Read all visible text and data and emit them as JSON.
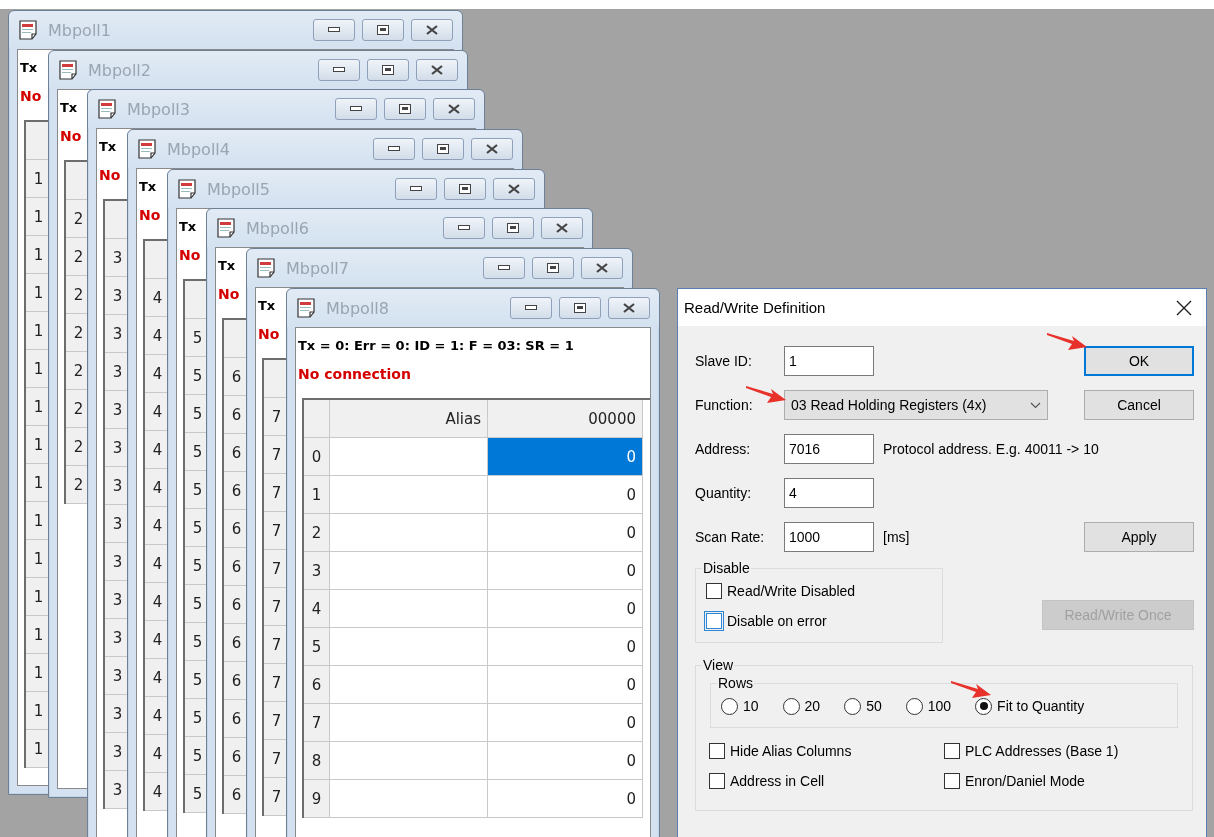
{
  "windows": [
    {
      "title": "Mbpoll1",
      "status": "Tx",
      "connection": "No",
      "row_headers": [
        "1",
        "1",
        "1",
        "1",
        "1",
        "1",
        "1",
        "1",
        "1",
        "1",
        "1",
        "1",
        "1",
        "1",
        "1",
        "1"
      ]
    },
    {
      "title": "Mbpoll2",
      "status": "Tx",
      "connection": "No",
      "row_headers": [
        "2",
        "2",
        "2",
        "2",
        "2",
        "2",
        "2",
        "2"
      ]
    },
    {
      "title": "Mbpoll3",
      "status": "Tx",
      "connection": "No",
      "row_headers": [
        "3",
        "3",
        "3",
        "3",
        "3",
        "3",
        "3",
        "3",
        "3",
        "3",
        "3",
        "3",
        "3",
        "3",
        "3"
      ]
    },
    {
      "title": "Mbpoll4",
      "status": "Tx",
      "connection": "No",
      "row_headers": [
        "4",
        "4",
        "4",
        "4",
        "4",
        "4",
        "4",
        "4",
        "4",
        "4",
        "4",
        "4",
        "4",
        "4"
      ]
    },
    {
      "title": "Mbpoll5",
      "status": "Tx",
      "connection": "No",
      "row_headers": [
        "5",
        "5",
        "5",
        "5",
        "5",
        "5",
        "5",
        "5",
        "5",
        "5",
        "5",
        "5",
        "5"
      ]
    },
    {
      "title": "Mbpoll6",
      "status": "Tx",
      "connection": "No",
      "row_headers": [
        "6",
        "6",
        "6",
        "6",
        "6",
        "6",
        "6",
        "6",
        "6",
        "6",
        "6",
        "6"
      ]
    },
    {
      "title": "Mbpoll7",
      "status": "Tx",
      "connection": "No",
      "row_headers": [
        "7",
        "7",
        "7",
        "7",
        "7",
        "7",
        "7",
        "7",
        "7",
        "7",
        "7"
      ]
    },
    {
      "title": "Mbpoll8",
      "status": "Tx = 0: Err = 0: ID = 1: F = 03: SR = 1",
      "connection": "No connection",
      "columns": [
        "Alias",
        "00000"
      ],
      "row_headers": [
        "0",
        "1",
        "2",
        "3",
        "4",
        "5",
        "6",
        "7",
        "8",
        "9"
      ],
      "cells": [
        {
          "value": "0",
          "selected": true
        },
        {
          "value": "0",
          "selected": false
        },
        {
          "value": "0",
          "selected": false
        },
        {
          "value": "0",
          "selected": false
        },
        {
          "value": "0",
          "selected": false
        },
        {
          "value": "0",
          "selected": false
        },
        {
          "value": "0",
          "selected": false
        },
        {
          "value": "0",
          "selected": false
        },
        {
          "value": "0",
          "selected": false
        },
        {
          "value": "0",
          "selected": false
        }
      ]
    }
  ],
  "dialog": {
    "title": "Read/Write Definition",
    "fields": [
      {
        "kind": "text",
        "label": "Slave ID:",
        "value": "1",
        "marked": false
      },
      {
        "kind": "select",
        "label": "Function:",
        "value": "03 Read Holding Registers (4x)",
        "marked": true
      },
      {
        "kind": "text",
        "label": "Address:",
        "value": "7016",
        "hint": "Protocol address. E.g. 40011 -> 10",
        "marked": false
      },
      {
        "kind": "text",
        "label": "Quantity:",
        "value": "4",
        "marked": false
      },
      {
        "kind": "text",
        "label": "Scan Rate:",
        "value": "1000",
        "hint": "[ms]",
        "marked": false
      }
    ],
    "buttons": [
      {
        "label": "OK",
        "default": true,
        "disabled": false,
        "marked": true
      },
      {
        "label": "Cancel",
        "default": false,
        "disabled": false,
        "marked": false
      },
      {
        "label": "Apply",
        "default": false,
        "disabled": false,
        "marked": false
      },
      {
        "label": "Read/Write Once",
        "default": false,
        "disabled": true,
        "marked": false
      }
    ],
    "disable_group": {
      "title": "Disable",
      "options": [
        {
          "label": "Read/Write Disabled",
          "checked": false,
          "highlighted": false
        },
        {
          "label": "Disable on error",
          "checked": false,
          "highlighted": true
        }
      ]
    },
    "view_group": {
      "title": "View",
      "rows_group": {
        "title": "Rows",
        "options": [
          {
            "label": "10",
            "selected": false,
            "marked": false
          },
          {
            "label": "20",
            "selected": false,
            "marked": false
          },
          {
            "label": "50",
            "selected": false,
            "marked": false
          },
          {
            "label": "100",
            "selected": false,
            "marked": false
          },
          {
            "label": "Fit to Quantity",
            "selected": true,
            "marked": true
          }
        ]
      },
      "options": [
        {
          "label": "Hide Alias Columns",
          "checked": false,
          "highlighted": false
        },
        {
          "label": "PLC Addresses (Base 1)",
          "checked": false,
          "highlighted": false
        },
        {
          "label": "Address in Cell",
          "checked": false,
          "highlighted": false
        },
        {
          "label": "Enron/Daniel Mode",
          "checked": false,
          "highlighted": false
        }
      ]
    }
  }
}
